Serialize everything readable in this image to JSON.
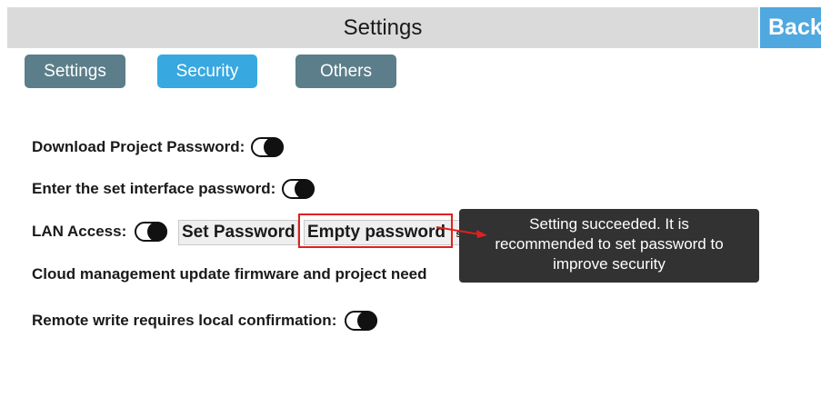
{
  "header": {
    "title": "Settings",
    "back_label": "Back"
  },
  "tabs": [
    {
      "label": "Settings"
    },
    {
      "label": "Security"
    },
    {
      "label": "Others"
    }
  ],
  "rows": {
    "download_project_password": {
      "label": "Download Project Password:",
      "toggle_icon": "toggle-icon"
    },
    "enter_set_interface_password": {
      "label": "Enter the set interface password:",
      "toggle_icon": "toggle-icon"
    },
    "lan_access": {
      "label": "LAN Access:",
      "toggle_icon": "toggle-icon",
      "set_password_label": "Set Password",
      "empty_password_label": "Empty password",
      "partial_hidden_label": "ssword"
    },
    "cloud_management": {
      "label": "Cloud management update firmware and project need"
    },
    "remote_write": {
      "label": "Remote write requires local confirmation:",
      "toggle_icon": "toggle-icon"
    }
  },
  "toast": {
    "line1": "Setting succeeded. It is",
    "line2": "recommended to set password to",
    "line3": "improve security"
  },
  "colors": {
    "accent": "#38a8e0",
    "tab_inactive": "#5b7e8a",
    "highlight": "#e02020",
    "toast_bg": "#323232"
  }
}
